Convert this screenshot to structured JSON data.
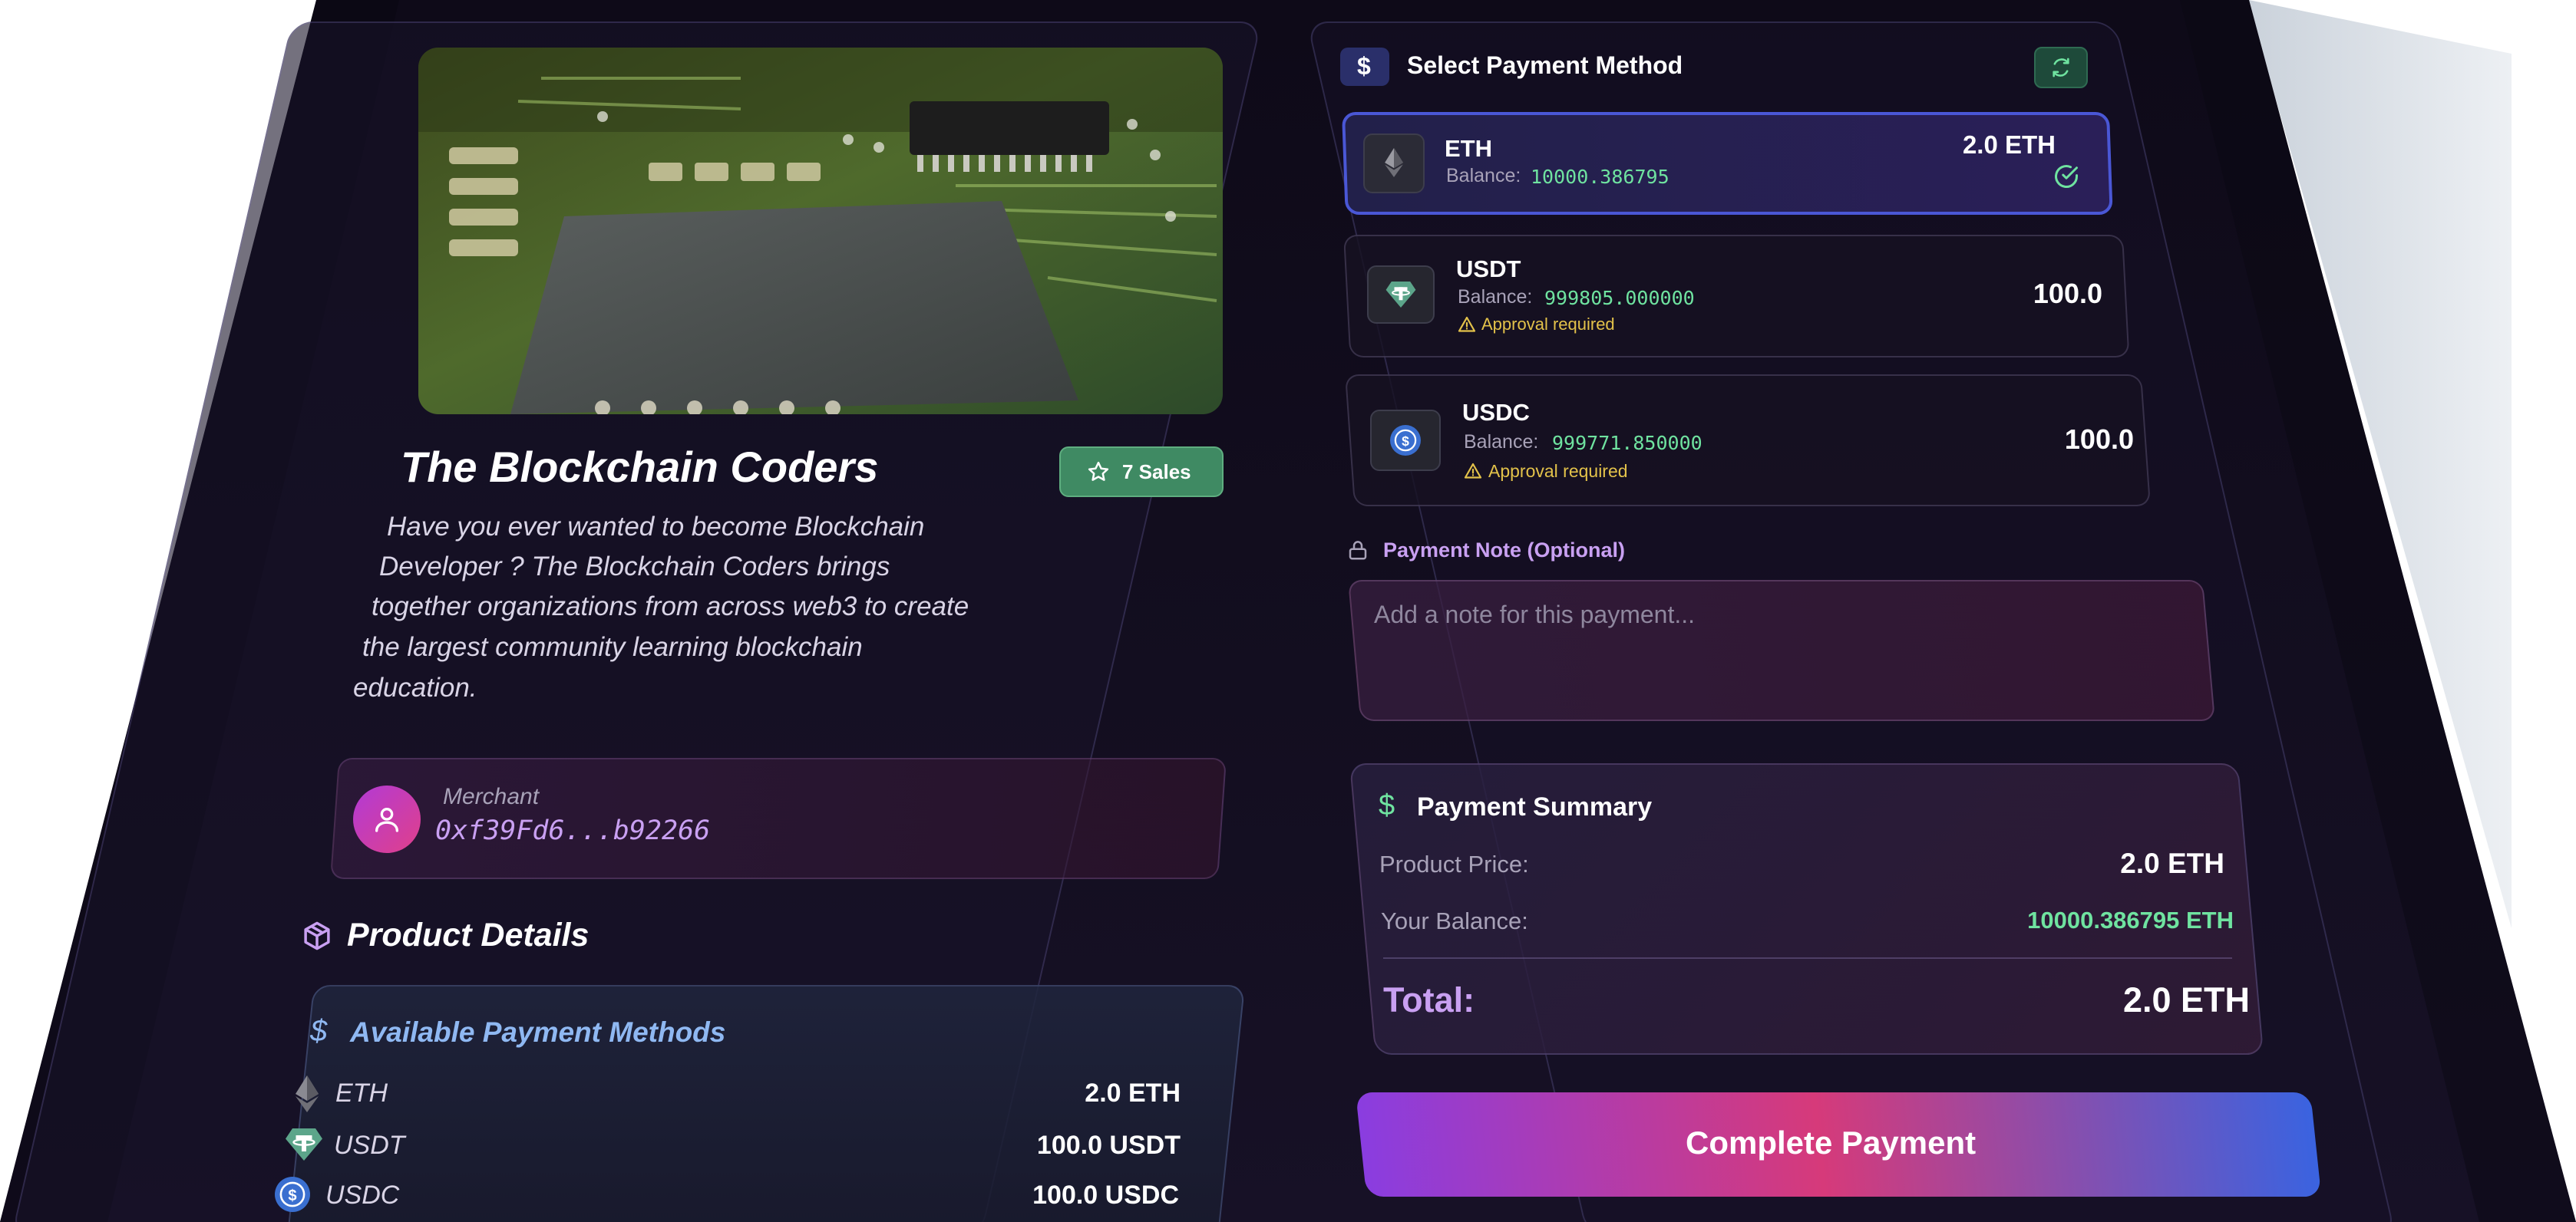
{
  "product": {
    "title": "The Blockchain Coders",
    "sales_badge": "7 Sales",
    "description_lines": [
      "Have you ever wanted to become Blockchain",
      "Developer ? The Blockchain Coders brings",
      "together organizations from across web3 to create",
      "the largest community learning blockchain",
      "education."
    ],
    "merchant_label": "Merchant",
    "merchant_address": "0xf39Fd6...b92266",
    "details_heading": "Product Details",
    "available_methods_heading": "Available Payment Methods",
    "available_methods": [
      {
        "icon": "ethereum-icon",
        "name": "ETH",
        "amount": "2.0 ETH"
      },
      {
        "icon": "tether-icon",
        "name": "USDT",
        "amount": "100.0 USDT"
      },
      {
        "icon": "usdc-icon",
        "name": "USDC",
        "amount": "100.0 USDC"
      }
    ]
  },
  "payment": {
    "heading": "Select Payment Method",
    "methods": [
      {
        "icon": "ethereum-icon",
        "name": "ETH",
        "balance_label": "Balance:",
        "balance": "10000.386795",
        "amount": "2.0 ETH",
        "selected": true,
        "warning": ""
      },
      {
        "icon": "tether-icon",
        "name": "USDT",
        "balance_label": "Balance:",
        "balance": "999805.000000",
        "amount": "100.0",
        "selected": false,
        "warning": "Approval required"
      },
      {
        "icon": "usdc-icon",
        "name": "USDC",
        "balance_label": "Balance:",
        "balance": "999771.850000",
        "amount": "100.0",
        "selected": false,
        "warning": "Approval required"
      }
    ],
    "note_label": "Payment Note (Optional)",
    "note_placeholder": "Add a note for this payment...",
    "summary": {
      "heading": "Payment Summary",
      "product_price_label": "Product Price:",
      "product_price": "2.0 ETH",
      "balance_label": "Your Balance:",
      "balance": "10000.386795 ETH",
      "total_label": "Total:",
      "total": "2.0 ETH"
    },
    "complete_button": "Complete Payment"
  },
  "colors": {
    "background": "#120d1e",
    "accent_purple": "#8a3de0",
    "accent_pink": "#d63a7a",
    "accent_blue": "#3a63e0",
    "success_green": "#6fe3a0",
    "sales_badge_green": "#3f8a63",
    "warning_yellow": "#e3c24a",
    "lavender_text": "#c9a0f2",
    "light_blue_text": "#8fb8f2"
  }
}
